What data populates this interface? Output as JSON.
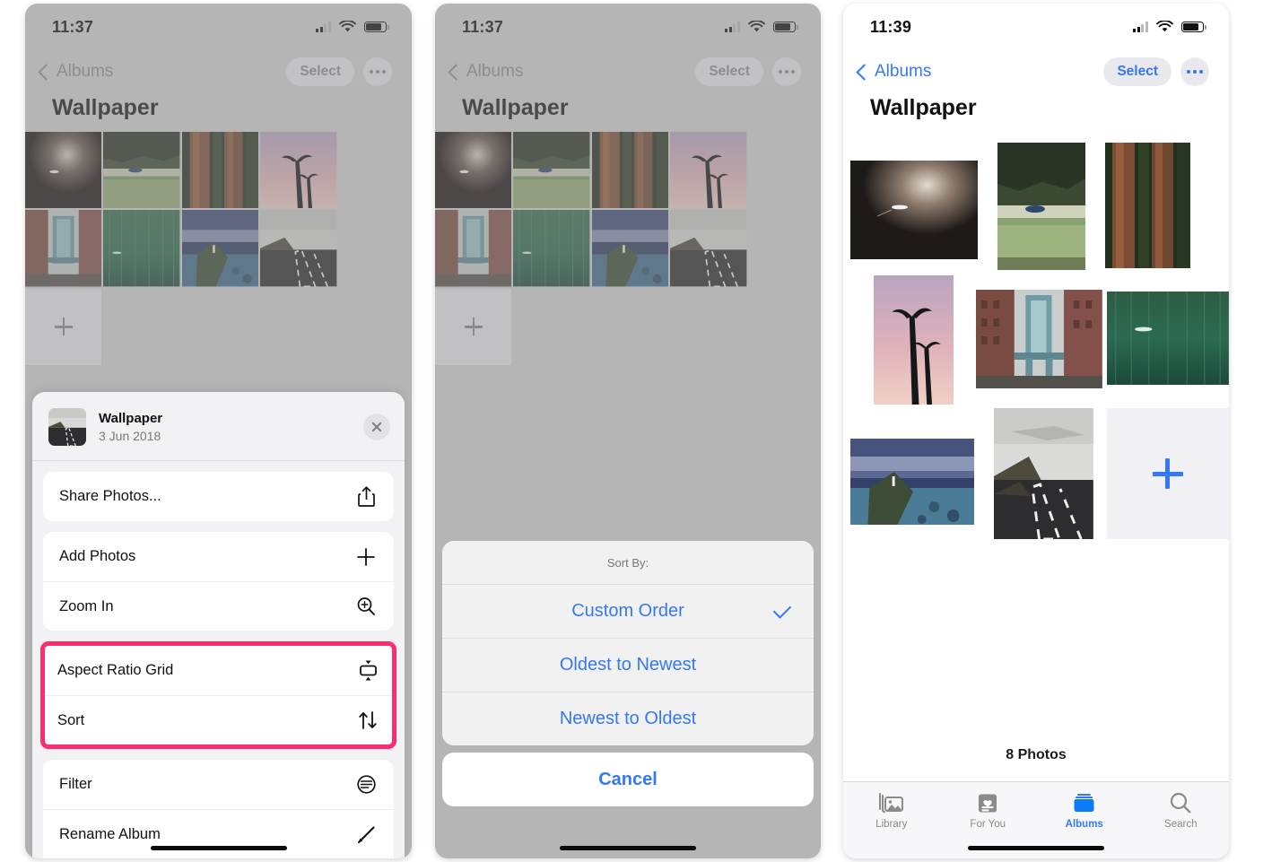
{
  "panels": [
    {
      "id": "panel-menu",
      "status": {
        "time": "11:37",
        "wifi_icon": "wifi-icon",
        "battery_icon": "battery-icon",
        "signal_icon": "cellular-signal-icon"
      },
      "nav": {
        "back_label": "Albums",
        "back_icon": "chevron-left-icon",
        "select_label": "Select",
        "more_icon": "ellipsis-icon"
      },
      "title": "Wallpaper",
      "sheet": {
        "album_name": "Wallpaper",
        "album_date": "3 Jun 2018",
        "close_icon": "close-icon",
        "thumbnail_name": "road-thumbnail",
        "items": [
          {
            "label": "Share Photos...",
            "icon": "share-icon",
            "highlighted": false
          },
          {
            "label": "Add Photos",
            "icon": "plus-icon",
            "highlighted": false
          },
          {
            "label": "Zoom In",
            "icon": "zoom-in-icon",
            "highlighted": false
          },
          {
            "label": "Aspect Ratio Grid",
            "icon": "aspect-ratio-icon",
            "highlighted": true
          },
          {
            "label": "Sort",
            "icon": "sort-arrows-icon",
            "highlighted": true
          },
          {
            "label": "Filter",
            "icon": "filter-icon",
            "highlighted": false
          },
          {
            "label": "Rename Album",
            "icon": "pencil-icon",
            "highlighted": false
          }
        ]
      }
    },
    {
      "id": "panel-sort",
      "status": {
        "time": "11:37"
      },
      "nav": {
        "back_label": "Albums",
        "select_label": "Select"
      },
      "title": "Wallpaper",
      "alert": {
        "title": "Sort By:",
        "options": [
          {
            "label": "Custom Order",
            "selected": true
          },
          {
            "label": "Oldest to Newest",
            "selected": false
          },
          {
            "label": "Newest to Oldest",
            "selected": false
          }
        ],
        "cancel_label": "Cancel",
        "check_icon": "checkmark-icon"
      }
    },
    {
      "id": "panel-aspect-grid",
      "status": {
        "time": "11:39"
      },
      "nav": {
        "back_label": "Albums",
        "select_label": "Select"
      },
      "title": "Wallpaper",
      "photo_count": "8 Photos",
      "add_icon": "plus-icon",
      "tabs": [
        {
          "label": "Library",
          "icon": "photos-library-icon",
          "active": false
        },
        {
          "label": "For You",
          "icon": "for-you-icon",
          "active": false
        },
        {
          "label": "Albums",
          "icon": "albums-icon",
          "active": true
        },
        {
          "label": "Search",
          "icon": "search-icon",
          "active": false
        }
      ]
    }
  ],
  "photos": [
    {
      "name": "abstract-clouds",
      "alt": "blurred dark abstract sky"
    },
    {
      "name": "lake-forest",
      "alt": "forest lake with boat"
    },
    {
      "name": "redwood-trees",
      "alt": "tall redwood tree trunks"
    },
    {
      "name": "palm-trees-sunset",
      "alt": "palm trees against pink sky"
    },
    {
      "name": "manhattan-bridge",
      "alt": "Manhattan bridge between brick buildings"
    },
    {
      "name": "green-water",
      "alt": "aerial green water with boat"
    },
    {
      "name": "lighthouse-coast",
      "alt": "lighthouse on coastal headland"
    },
    {
      "name": "open-road",
      "alt": "highway through grey landscape"
    }
  ],
  "colors": {
    "accent_blue": "#3478f6",
    "highlight_pink": "#fa2d6e",
    "sheet_bg": "#f2f2f4",
    "dim_bg": "#d2d2d2",
    "tab_inactive": "#8a8a8f"
  }
}
